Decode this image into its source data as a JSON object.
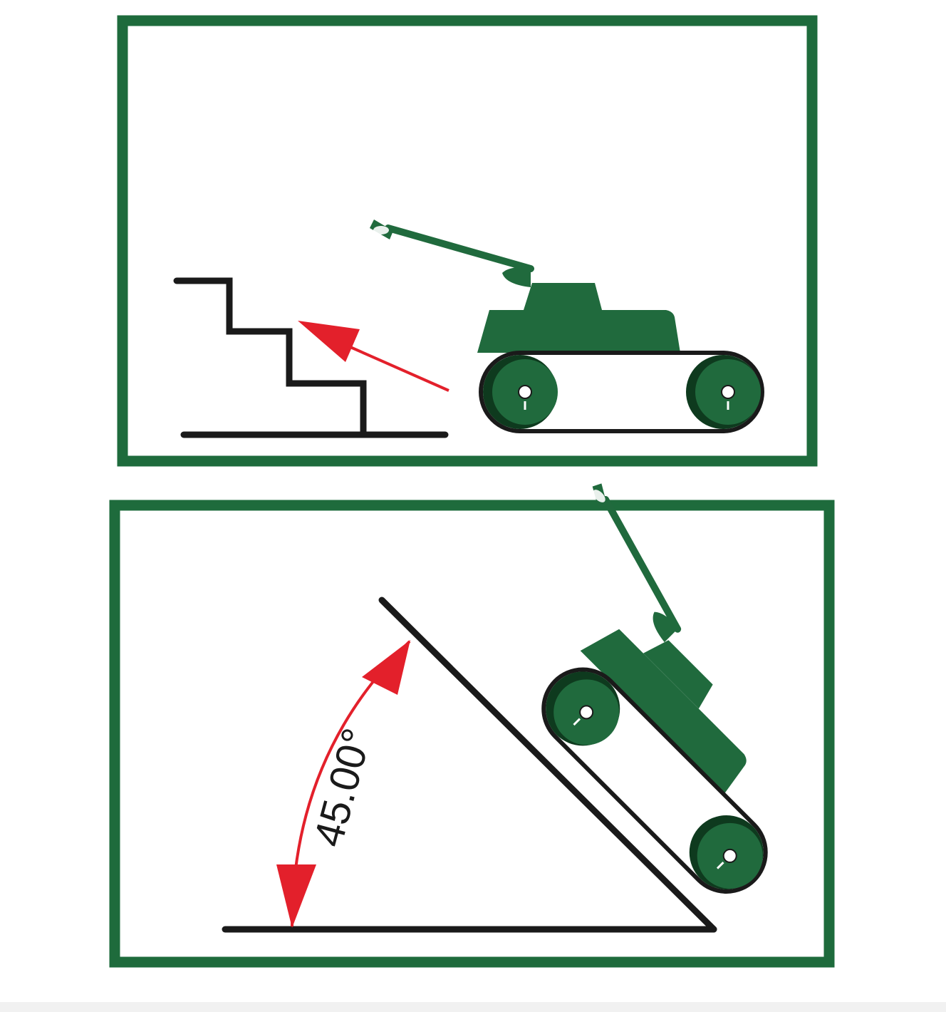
{
  "colors": {
    "frame": "#1e6b3c",
    "tank_body": "#206a3d",
    "tank_dark": "#0e3a1e",
    "line": "#1a1a1a",
    "arrow": "#e3202b",
    "background": "#ffffff"
  },
  "panels": [
    {
      "name": "stairs-panel",
      "obstacle": "stairs",
      "icons": [
        "stairs-icon",
        "tank-icon",
        "arrow-icon"
      ]
    },
    {
      "name": "slope-panel",
      "obstacle": "slope",
      "angle_label": "45.00°",
      "icons": [
        "slope-icon",
        "tank-icon",
        "angle-arc-icon"
      ]
    }
  ]
}
